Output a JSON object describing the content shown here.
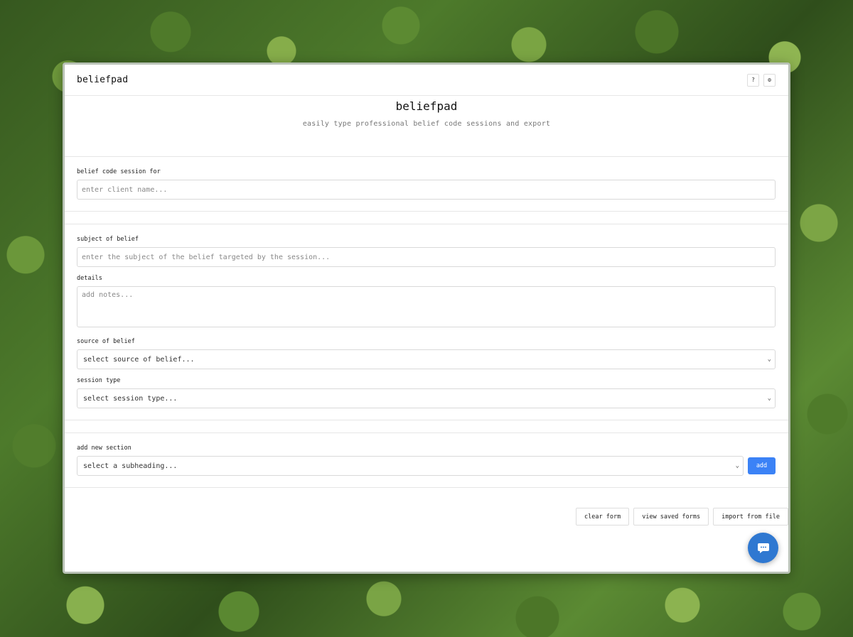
{
  "topbar": {
    "brand": "beliefpad",
    "help_label": "?",
    "settings_label": "⚙"
  },
  "hero": {
    "title": "beliefpad",
    "subtitle": "easily type professional belief code sessions and export"
  },
  "client": {
    "label": "belief code session for",
    "placeholder": "enter client name..."
  },
  "belief": {
    "subject_label": "subject of belief",
    "subject_placeholder": "enter the subject of the belief targeted by the session...",
    "details_label": "details",
    "details_placeholder": "add notes...",
    "source_label": "source of belief",
    "source_value": "select source of belief...",
    "session_type_label": "session type",
    "session_type_value": "select session type..."
  },
  "add_section": {
    "label": "add new section",
    "select_value": "select a subheading...",
    "button": "add"
  },
  "actions": {
    "clear": "clear form",
    "view_saved": "view saved forms",
    "import": "import from file"
  },
  "colors": {
    "accent": "#3b82f6",
    "chat": "#2f78d1"
  }
}
